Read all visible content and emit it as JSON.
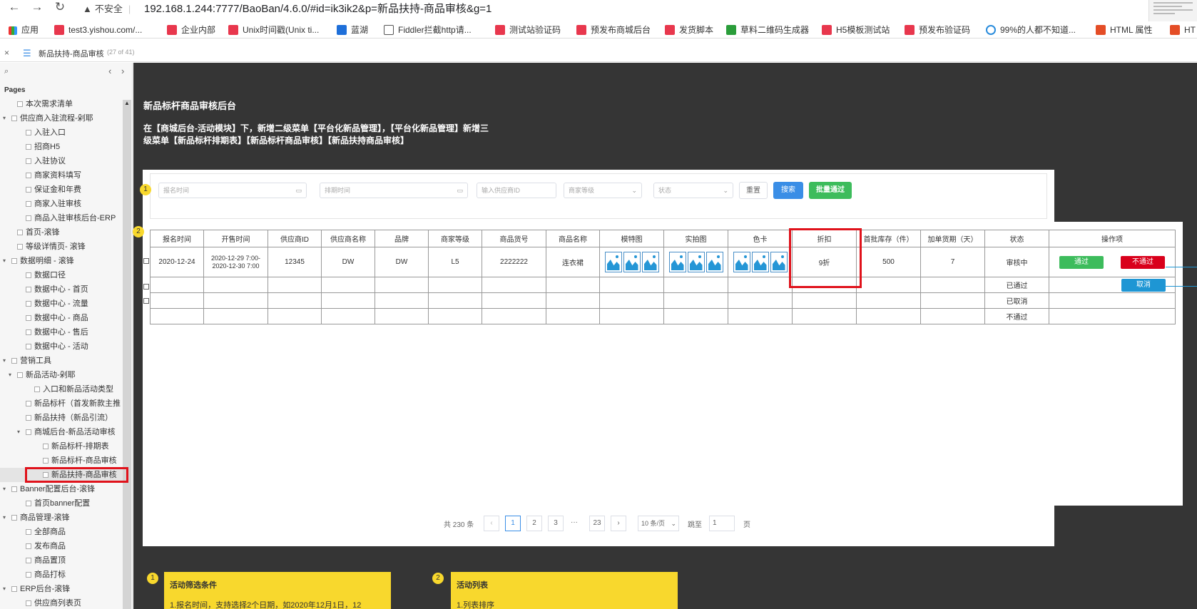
{
  "browser": {
    "security": "不安全",
    "url": "192.168.1.244:7777/BaoBan/4.6.0/#id=ik3ik2&p=新品扶持-商品审核&g=1",
    "bookmarks": [
      "应用",
      "test3.yishou.com/...",
      "企业内部",
      "Unix时间戳(Unix ti...",
      "蓝湖",
      "Fiddler拦截http请...",
      "测试站验证码",
      "预发布商城后台",
      "发货脚本",
      "草料二维码生成器",
      "H5模板测试站",
      "预发布验证码",
      "99%的人都不知道...",
      "HTML 属性",
      "HT"
    ]
  },
  "tab": {
    "title": "新品扶持-商品审核",
    "count": "(27 of 41)"
  },
  "sidebar": {
    "pages_label": "Pages",
    "items": [
      {
        "label": "本次需求清单",
        "level": 1,
        "toggle": ""
      },
      {
        "label": "供应商入驻流程-剁耶",
        "level": 0,
        "toggle": "▾"
      },
      {
        "label": "入驻入口",
        "level": 2,
        "toggle": ""
      },
      {
        "label": "招商H5",
        "level": 2,
        "toggle": ""
      },
      {
        "label": "入驻协议",
        "level": 2,
        "toggle": ""
      },
      {
        "label": "商家资料填写",
        "level": 2,
        "toggle": ""
      },
      {
        "label": "保证金和年费",
        "level": 2,
        "toggle": ""
      },
      {
        "label": "商家入驻审核",
        "level": 2,
        "toggle": ""
      },
      {
        "label": "商品入驻审核后台-ERP",
        "level": 2,
        "toggle": ""
      },
      {
        "label": "首页-滚锋",
        "level": 1,
        "toggle": ""
      },
      {
        "label": "等级详情页- 滚锋",
        "level": 1,
        "toggle": ""
      },
      {
        "label": "数据明细 - 滚锋",
        "level": 0,
        "toggle": "▾"
      },
      {
        "label": "数据口径",
        "level": 2,
        "toggle": ""
      },
      {
        "label": "数据中心 - 首页",
        "level": 2,
        "toggle": ""
      },
      {
        "label": "数据中心 - 流量",
        "level": 2,
        "toggle": ""
      },
      {
        "label": "数据中心 - 商品",
        "level": 2,
        "toggle": ""
      },
      {
        "label": "数据中心 - 售后",
        "level": 2,
        "toggle": ""
      },
      {
        "label": "数据中心 - 活动",
        "level": 2,
        "toggle": ""
      },
      {
        "label": "营销工具",
        "level": 0,
        "toggle": "▾"
      },
      {
        "label": "新品活动-剁耶",
        "level": 1,
        "toggle": "▾"
      },
      {
        "label": "入口和新品活动类型",
        "level": 3,
        "toggle": ""
      },
      {
        "label": "新品标杆（首发新款主推",
        "level": 2,
        "toggle": ""
      },
      {
        "label": "新品扶持（新品引流）",
        "level": 2,
        "toggle": ""
      },
      {
        "label": "商城后台-新品活动审核",
        "level": 2,
        "toggle": "▾"
      },
      {
        "label": "新品标杆-排期表",
        "level": 4,
        "toggle": ""
      },
      {
        "label": "新品标杆-商品审核",
        "level": 4,
        "toggle": ""
      },
      {
        "label": "新品扶持-商品审核",
        "level": 4,
        "toggle": "",
        "selected": true
      },
      {
        "label": "Banner配置后台-滚锋",
        "level": 0,
        "toggle": "▾"
      },
      {
        "label": "首页banner配置",
        "level": 2,
        "toggle": ""
      },
      {
        "label": "商品管理-滚锋",
        "level": 0,
        "toggle": "▾"
      },
      {
        "label": "全部商品",
        "level": 2,
        "toggle": ""
      },
      {
        "label": "发布商品",
        "level": 2,
        "toggle": ""
      },
      {
        "label": "商品置顶",
        "level": 2,
        "toggle": ""
      },
      {
        "label": "商品打标",
        "level": 2,
        "toggle": ""
      },
      {
        "label": "ERP后台-滚锋",
        "level": 0,
        "toggle": "▾"
      },
      {
        "label": "供应商列表页",
        "level": 2,
        "toggle": ""
      }
    ]
  },
  "canvas": {
    "heading": "新品标杆商品审核后台",
    "desc_line1": "在【商城后台-活动模块】下，新增二级菜单【平台化新品管理】，【平台化新品管理】新增三",
    "desc_line2": "级菜单【新品标杆排期表】【新品标杆商品审核】【新品扶持商品审核】",
    "markers": [
      "1",
      "2"
    ],
    "filters": {
      "signup_time": "报名时间",
      "schedule_time": "排期时间",
      "supplier_id": "输入供应商ID",
      "merchant_level": "商家等级",
      "status": "状态",
      "reset": "重置",
      "search": "搜索",
      "batch_approve": "批量通过"
    },
    "table": {
      "headers": [
        "报名时间",
        "开售时间",
        "供应商ID",
        "供应商名称",
        "品牌",
        "商家等级",
        "商品货号",
        "商品名称",
        "模特图",
        "实拍图",
        "色卡",
        "折扣",
        "首批库存（件）",
        "加单货期（天）",
        "状态",
        "操作项"
      ],
      "row": {
        "signup": "2020-12-24",
        "sale_start": "2020-12-29 7:00-",
        "sale_end": "2020-12-30 7:00",
        "supplier_id": "12345",
        "supplier_name": "DW",
        "brand": "DW",
        "level": "L5",
        "sku": "2222222",
        "name": "连衣裙",
        "discount": "9折",
        "stock": "500",
        "lead": "7"
      },
      "statuses": [
        "审核中",
        "已通过",
        "已取消",
        "不通过"
      ],
      "actions": {
        "approve": "通过",
        "reject": "不通过",
        "cancel": "取消"
      }
    },
    "pagination": {
      "total": "共 230 条",
      "prev": "‹",
      "pages": [
        "1",
        "2",
        "3"
      ],
      "ellipsis": "···",
      "last": "23",
      "next": "›",
      "page_size": "10 条/页",
      "goto_label": "跳至",
      "goto_value": "1",
      "page_unit": "页",
      "current": 1
    },
    "notes": [
      {
        "num": "1",
        "title": "活动筛选条件",
        "text": "1.报名时间，支持选择2个日期，如2020年12月1日，12"
      },
      {
        "num": "2",
        "title": "活动列表",
        "text": "1.列表排序"
      }
    ]
  },
  "colors": {
    "accent_blue": "#3a8ee6",
    "green": "#3dbc5c",
    "red": "#d9001b",
    "note_yellow": "#f8d82d",
    "highlight": "#e0121b"
  }
}
